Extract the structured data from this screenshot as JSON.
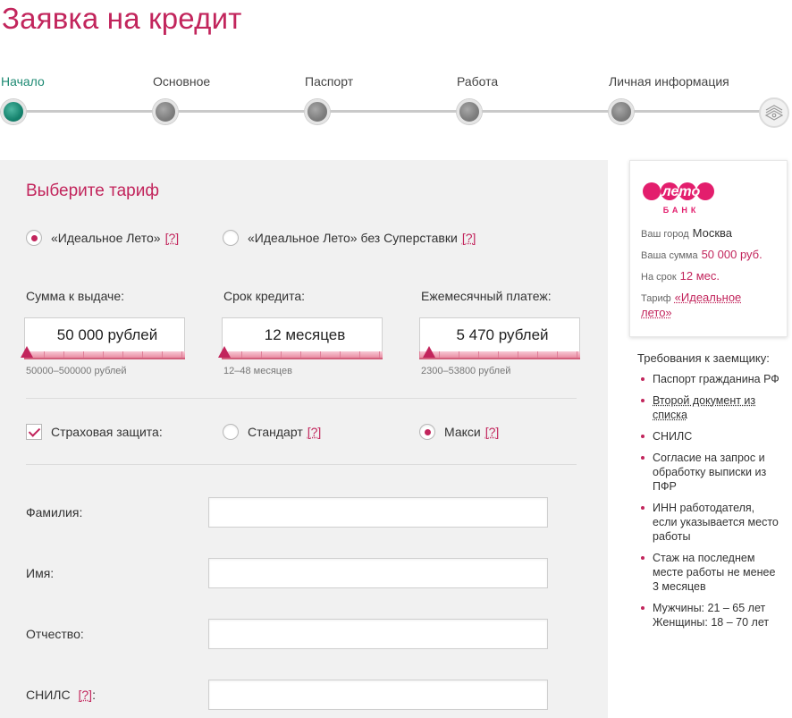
{
  "page_title": "Заявка на кредит",
  "stepper": {
    "steps": [
      {
        "label": "Начало",
        "active": true
      },
      {
        "label": "Основное",
        "active": false
      },
      {
        "label": "Паспорт",
        "active": false
      },
      {
        "label": "Работа",
        "active": false
      },
      {
        "label": "Личная информация",
        "active": false
      }
    ],
    "finish_icon": "money-stack-icon"
  },
  "tariff": {
    "title": "Выберите тариф",
    "options": [
      {
        "label": "«Идеальное Лето»",
        "help": "[?]",
        "checked": true
      },
      {
        "label": "«Идеальное Лето» без Суперставки",
        "help": "[?]",
        "checked": false
      }
    ]
  },
  "loan": {
    "amount": {
      "label": "Сумма к выдаче:",
      "value": "50 000 рублей",
      "range": "50000–500000 рублей"
    },
    "term": {
      "label": "Срок кредита:",
      "value": "12 месяцев",
      "range": "12–48 месяцев"
    },
    "monthly": {
      "label": "Ежемесячный платеж:",
      "value": "5 470 рублей",
      "range": "2300–53800 рублей"
    }
  },
  "insurance": {
    "label": "Страховая защита:",
    "checked": true,
    "options": [
      {
        "label": "Стандарт",
        "help": "[?]",
        "checked": false
      },
      {
        "label": "Макси",
        "help": "[?]",
        "checked": true
      }
    ]
  },
  "personal": {
    "surname": {
      "label": "Фамилия:",
      "value": ""
    },
    "name": {
      "label": "Имя:",
      "value": ""
    },
    "patronymic": {
      "label": "Отчество:",
      "value": ""
    },
    "snils": {
      "label": "СНИЛС",
      "help": "[?]",
      "suffix": ":",
      "value": ""
    }
  },
  "summary": {
    "bank_logo_text": "лето",
    "bank_logo_sub": "БАНК",
    "city_label": "Ваш город",
    "city": "Москва",
    "sum_label": "Ваша сумма",
    "sum": "50 000 руб.",
    "term_label": "На срок",
    "term": "12 мес.",
    "tariff_label": "Тариф",
    "tariff": "«Идеальное лето»"
  },
  "requirements": {
    "title": "Требования к заемщику:",
    "items": [
      "Паспорт гражданина РФ",
      "Второй документ из списка",
      "СНИЛС",
      "Согласие на запрос и обработку выписки из ПФР",
      "ИНН работодателя, если указывается место работы",
      "Стаж на последнем месте работы не менее 3 месяцев",
      "Мужчины: 21 – 65 лет Женщины: 18 – 70 лет"
    ]
  },
  "colors": {
    "accent": "#c2255c",
    "active_step": "#16836e",
    "panel": "#f1f1f1"
  }
}
